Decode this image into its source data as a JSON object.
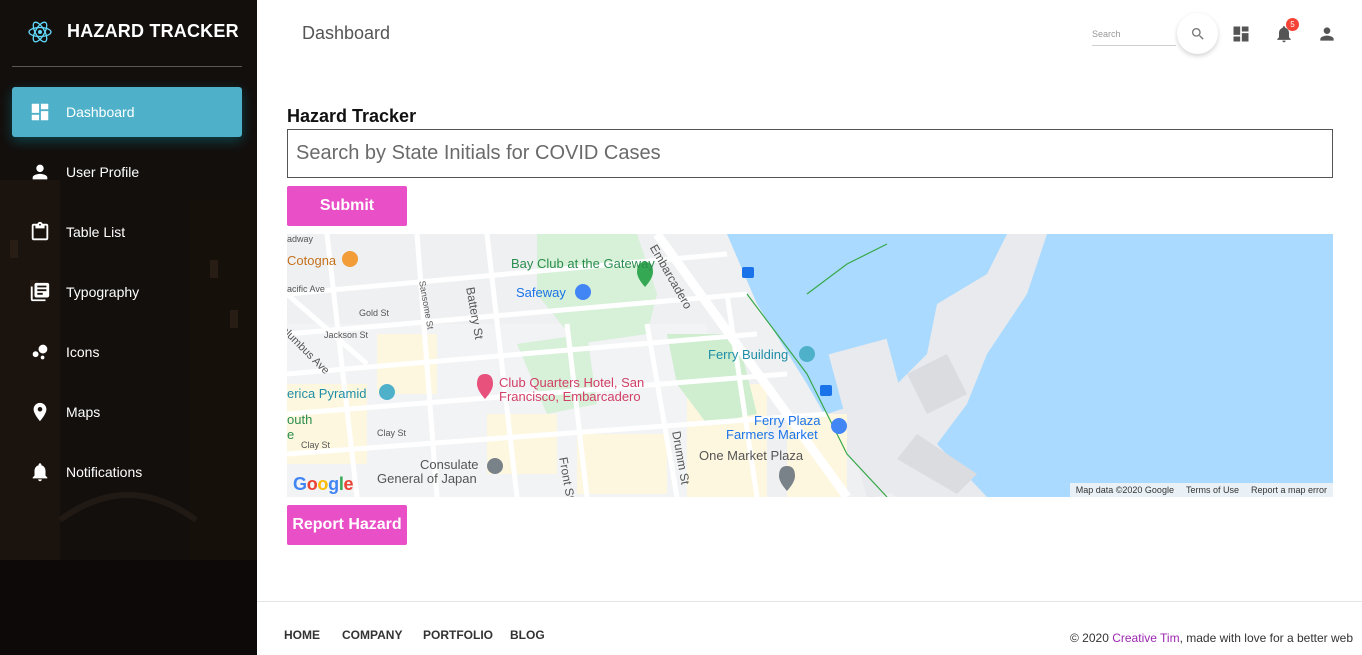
{
  "sidebar": {
    "brand": "HAZARD TRACKER",
    "logo_icon": "react-atom-icon",
    "items": [
      {
        "label": "Dashboard",
        "icon": "dashboard-icon",
        "active": true
      },
      {
        "label": "User Profile",
        "icon": "person-icon"
      },
      {
        "label": "Table List",
        "icon": "clipboard-icon"
      },
      {
        "label": "Typography",
        "icon": "library-books-icon"
      },
      {
        "label": "Icons",
        "icon": "bubble-chart-icon"
      },
      {
        "label": "Maps",
        "icon": "location-pin-icon"
      },
      {
        "label": "Notifications",
        "icon": "bell-icon"
      }
    ],
    "active_color": "#4fb1c9"
  },
  "header": {
    "title": "Dashboard",
    "search_placeholder": "Search",
    "notification_count": "5"
  },
  "main": {
    "heading": "Hazard Tracker",
    "search_placeholder": "Search by State Initials for COVID Cases",
    "submit_label": "Submit",
    "report_label": "Report Hazard",
    "button_color": "#e94fc6"
  },
  "map": {
    "labels": {
      "bay_club": "Bay Club at the Gateway",
      "safeway": "Safeway",
      "cotogna": "Cotogna",
      "ferry_building": "Ferry Building",
      "club_quarters_1": "Club Quarters Hotel, San",
      "club_quarters_2": "Francisco, Embarcadero",
      "america_pyramid": "erica Pyramid",
      "ferry_plaza_1": "Ferry Plaza",
      "ferry_plaza_2": "Farmers Market",
      "one_market": "One Market Plaza",
      "consulate_1": "Consulate",
      "consulate_2": "General of Japan",
      "embarcadero": "Embarcadero",
      "battery": "Battery St",
      "drumm": "Drumm St",
      "front": "Front St",
      "sansome": "Sansome St",
      "gold": "Gold St",
      "jackson": "Jackson St",
      "clay": "Clay St",
      "clay2": "Clay St",
      "columbus": "olumbus Ave",
      "pacific": "acific Ave",
      "broadway": "adway",
      "south": "outh",
      "e": "e"
    },
    "google": "Google",
    "attribution": [
      "Map data ©2020 Google",
      "Terms of Use",
      "Report a map error"
    ]
  },
  "footer": {
    "links": [
      "HOME",
      "COMPANY",
      "PORTFOLIO",
      "BLOG"
    ],
    "copyright_prefix": "© 2020 ",
    "copyright_brand": "Creative Tim",
    "copyright_suffix": ", made with love for a better web"
  }
}
